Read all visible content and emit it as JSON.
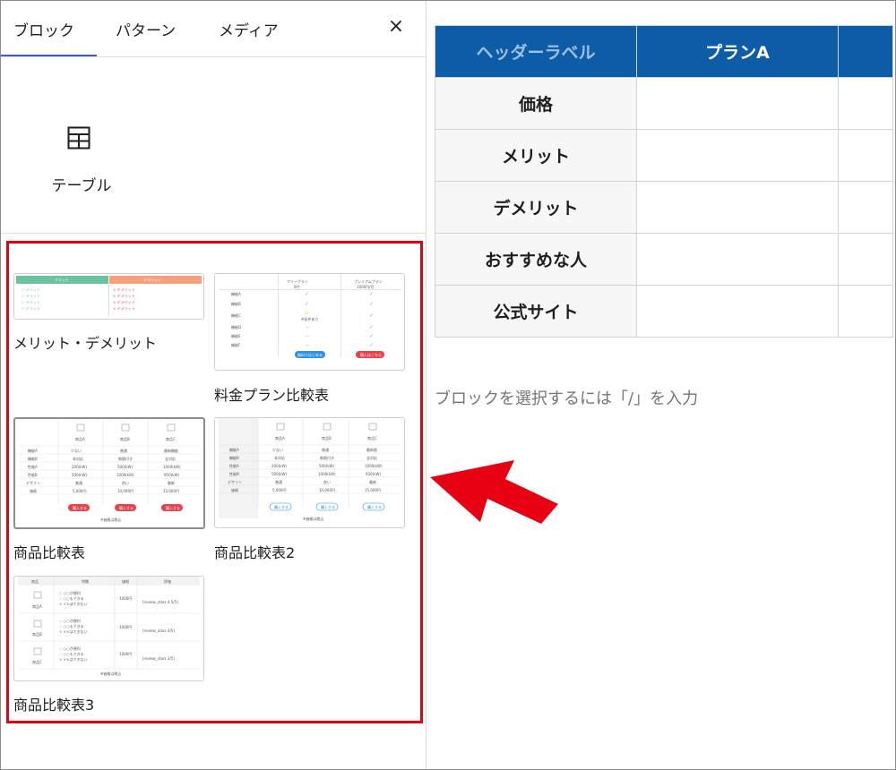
{
  "tabs": [
    {
      "label": "ブロック",
      "active": true
    },
    {
      "label": "パターン",
      "active": false
    },
    {
      "label": "メディア",
      "active": false
    }
  ],
  "close_label": "×",
  "block": {
    "label": "テーブル",
    "icon": "table-icon"
  },
  "patterns": {
    "merit": {
      "label": "メリット・デメリット",
      "merit_head": "メリット",
      "demerit_head": "デメリット",
      "merit_items": [
        "メリット",
        "メリット",
        "メリット",
        "メリット"
      ],
      "demerit_items": [
        "デメリット",
        "デメリット",
        "デメリット",
        "デメリット"
      ]
    },
    "pricing": {
      "label": "料金プラン比較表",
      "col1": "フリープラン",
      "col1_sub": "0円",
      "col2": "プレミアムプラン",
      "col2_sub": "1000円/月",
      "rows": [
        "機能A",
        "機能B",
        "機能C",
        "機能D",
        "機能E",
        "機能F"
      ],
      "note": "※条件あり",
      "btn1": "無料ではじめる",
      "btn2": "購入はこちら"
    },
    "product": {
      "label": "商品比較表",
      "cols": [
        "商品A",
        "商品B",
        "商品C"
      ],
      "rows": [
        {
          "h": "機能A",
          "v": [
            "少ない",
            "普通",
            "最新機能"
          ]
        },
        {
          "h": "機能B",
          "v": [
            "非対応",
            "制限付き",
            "全対応"
          ]
        },
        {
          "h": "性能A",
          "v": [
            "200(kW)",
            "500(kW)",
            "1000(kW)"
          ]
        },
        {
          "h": "性能B",
          "v": [
            "500(kW)",
            "1000(kW)",
            "950(kW)"
          ]
        },
        {
          "h": "デザイン",
          "v": [
            "普通",
            "良い",
            "最新"
          ]
        },
        {
          "h": "価格",
          "v": [
            "5,000円",
            "10,000円",
            "15,000円"
          ]
        }
      ],
      "btn": "購入する",
      "note": "※価格は税込"
    },
    "product2": {
      "label": "商品比較表2",
      "cols": [
        "商品A",
        "商品B",
        "商品C"
      ],
      "rows": [
        {
          "h": "機能A",
          "v": [
            "少ない",
            "普通",
            "最新版"
          ]
        },
        {
          "h": "機能B",
          "v": [
            "非対応",
            "制限付き",
            "全対応"
          ]
        },
        {
          "h": "性能A",
          "v": [
            "200(kW)",
            "500(kW)",
            "1000(kW)"
          ]
        },
        {
          "h": "性能B",
          "v": [
            "500(kW)",
            "1000(kW)",
            "930(kW)"
          ]
        },
        {
          "h": "デザイン",
          "v": [
            "普通",
            "良い",
            "最新"
          ]
        },
        {
          "h": "価格",
          "v": [
            "5,000円",
            "10,000円",
            "15,000円"
          ]
        }
      ],
      "btn": "購入する",
      "note": "※価格は税込"
    },
    "product3": {
      "label": "商品比較表3",
      "head": [
        "商品",
        "特徴",
        "価格",
        "評価"
      ],
      "items": [
        {
          "name": "商品A",
          "f": [
            "○○が便利",
            "○○もできる",
            "××はできない"
          ],
          "price": "1000円",
          "rating": "[review_stars 4.5/5]"
        },
        {
          "name": "商品B",
          "f": [
            "○○が便利",
            "○○もできる",
            "××はできない"
          ],
          "price": "1000円",
          "rating": "[review_stars 4/5]"
        },
        {
          "name": "商品C",
          "f": [
            "○○が便利",
            "○○もできる",
            "××はできない"
          ],
          "price": "1000円",
          "rating": "[review_stars 3/5]"
        }
      ],
      "note": "※価格は税込"
    }
  },
  "canvas": {
    "table": {
      "header": [
        "ヘッダーラベル",
        "プランA",
        ""
      ],
      "rows": [
        "価格",
        "メリット",
        "デメリット",
        "おすすめな人",
        "公式サイト"
      ]
    },
    "placeholder": "ブロックを選択するには「/」を入力"
  },
  "colors": {
    "accent": "#3858e9",
    "table_header": "#0d5ca8",
    "highlight": "#e60012",
    "merit": "#6cc3a0",
    "demerit": "#f6a07d",
    "buy": "#e8424c",
    "free_btn": "#2f8fe0"
  }
}
